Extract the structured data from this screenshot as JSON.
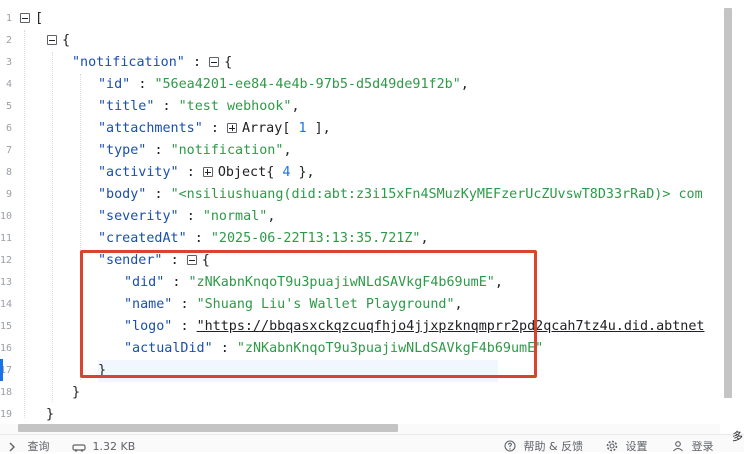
{
  "editor": {
    "line_numbers": [
      "1",
      "2",
      "3",
      "4",
      "5",
      "6",
      "7",
      "8",
      "9",
      "10",
      "11",
      "12",
      "13",
      "14",
      "15",
      "16",
      "17",
      "18",
      "19"
    ],
    "tokens": {
      "open_bracket": "[",
      "open_brace": "{",
      "colon": ":",
      "comma": ",",
      "close_brace": "}",
      "array_label": "Array",
      "object_label": "Object",
      "bracket_open": "[",
      "bracket_close": "]"
    },
    "notification": {
      "key": "\"notification\"",
      "fields": {
        "id": {
          "key": "\"id\"",
          "value": "\"56ea4201-ee84-4e4b-97b5-d5d49de91f2b\""
        },
        "title": {
          "key": "\"title\"",
          "value": "\"test webhook\""
        },
        "attachments": {
          "key": "\"attachments\"",
          "count": "1"
        },
        "type": {
          "key": "\"type\"",
          "value": "\"notification\""
        },
        "activity": {
          "key": "\"activity\"",
          "count": "4"
        },
        "body": {
          "key": "\"body\"",
          "value": "\"<nsiliushuang(did:abt:z3i15xFn4SMuzKyMEFzerUcZUvswT8D33rRaD)> com"
        },
        "severity": {
          "key": "\"severity\"",
          "value": "\"normal\""
        },
        "createdAt": {
          "key": "\"createdAt\"",
          "value": "\"2025-06-22T13:13:35.721Z\""
        }
      },
      "sender": {
        "key": "\"sender\"",
        "did": {
          "key": "\"did\"",
          "value": "\"zNKabnKnqoT9u3puajiwNLdSAVkgF4b69umE\""
        },
        "name": {
          "key": "\"name\"",
          "value": "\"Shuang Liu's Wallet Playground\""
        },
        "logo": {
          "key": "\"logo\"",
          "value": "\"https://bbqasxckqzcuqfhjo4jjxpzknqmprr2pd2qcah7tz4u.did.abtnet"
        },
        "actualDid": {
          "key": "\"actualDid\"",
          "value": "\"zNKabnKnqoT9u3puajiwNLdSAVkgF4b69umE\""
        }
      }
    }
  },
  "status_bar": {
    "query_label": "查询",
    "size_label": "1.32 KB",
    "help_label": "帮助 & 反馈",
    "settings_label": "设置",
    "login_label": "登录",
    "edge_text": "多"
  },
  "icons": {
    "chevron": "chevron-right-icon",
    "size": "car-icon",
    "help": "help-circle-icon",
    "settings": "gear-icon",
    "login": "user-icon"
  },
  "colors": {
    "key": "#1a4fb0",
    "string": "#2e9a48",
    "number": "#1a73e8",
    "highlight_box": "#d9442e"
  }
}
